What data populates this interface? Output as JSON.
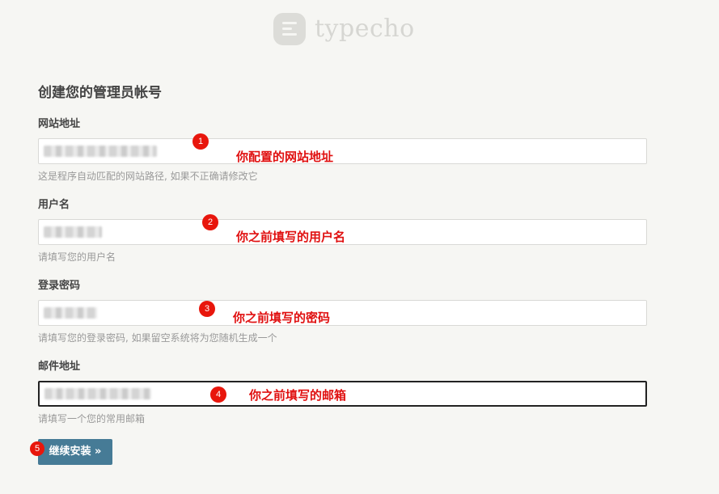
{
  "logo": {
    "text": "typecho"
  },
  "title": "创建您的管理员帐号",
  "fields": [
    {
      "label": "网站地址",
      "hint": "这是程序自动匹配的网站路径, 如果不正确请修改它",
      "marker": "1",
      "annotation": "你配置的网站地址"
    },
    {
      "label": "用户名",
      "hint": "请填写您的用户名",
      "marker": "2",
      "annotation": "你之前填写的用户名"
    },
    {
      "label": "登录密码",
      "hint": "请填写您的登录密码, 如果留空系统将为您随机生成一个",
      "marker": "3",
      "annotation": "你之前填写的密码"
    },
    {
      "label": "邮件地址",
      "hint": "请填写一个您的常用邮箱",
      "marker": "4",
      "annotation": "你之前填写的邮箱"
    }
  ],
  "submit": {
    "label": "继续安装 »",
    "marker": "5"
  },
  "colors": {
    "background": "#f6f6f3",
    "button": "#467b96",
    "annotation": "#e01010",
    "marker": "#e8160c"
  }
}
